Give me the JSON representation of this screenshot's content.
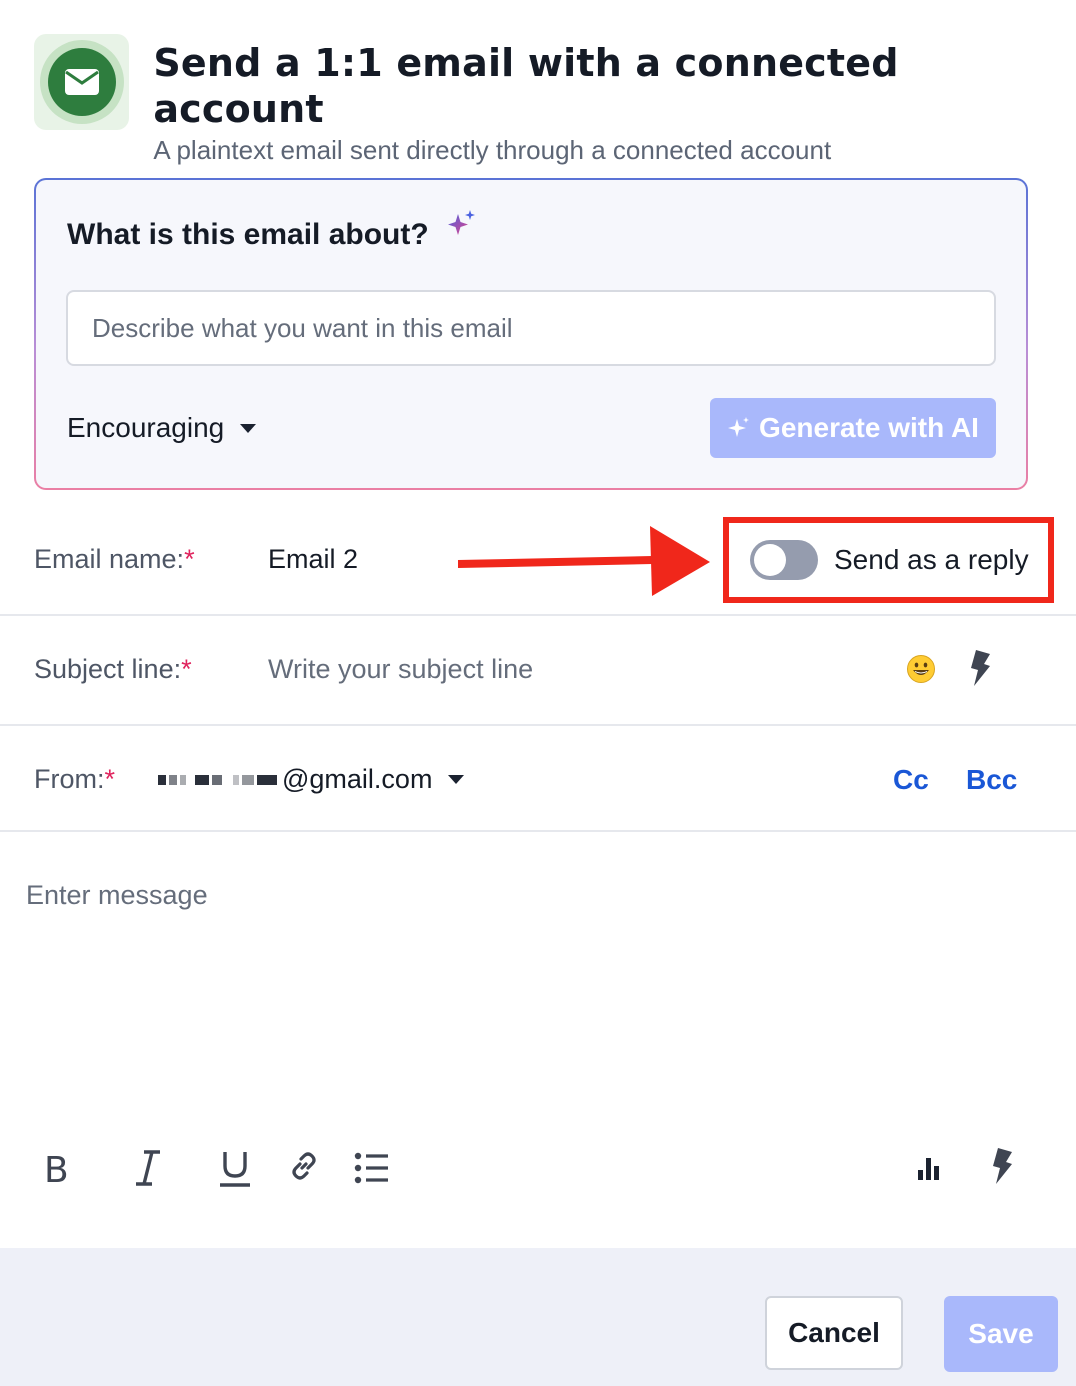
{
  "header": {
    "title": "Send a 1:1 email with a connected account",
    "subtitle": "A plaintext email sent directly through a connected account",
    "icon": "envelope-icon",
    "icon_color": "#2e7d3e"
  },
  "ai_panel": {
    "question": "What is this email about?",
    "input_placeholder": "Describe what you want in this email",
    "input_value": "",
    "tone_selected": "Encouraging",
    "generate_label": "Generate with AI"
  },
  "email_name": {
    "label": "Email name:",
    "required_mark": "*",
    "value": "Email 2"
  },
  "send_as_reply": {
    "label": "Send as a reply",
    "enabled": false
  },
  "subject": {
    "label": "Subject line:",
    "required_mark": "*",
    "placeholder": "Write your subject line",
    "value": ""
  },
  "from": {
    "label": "From:",
    "required_mark": "*",
    "value_visible": "@gmail.com",
    "cc_label": "Cc",
    "bcc_label": "Bcc"
  },
  "message": {
    "placeholder": "Enter message",
    "value": ""
  },
  "toolbar": {
    "bold_label": "B"
  },
  "footer": {
    "cancel_label": "Cancel",
    "save_label": "Save"
  },
  "colors": {
    "accent": "#1a57d6",
    "disabled_button": "#a9b8fb",
    "annotation_red": "#f0271b",
    "required": "#e0245e"
  }
}
